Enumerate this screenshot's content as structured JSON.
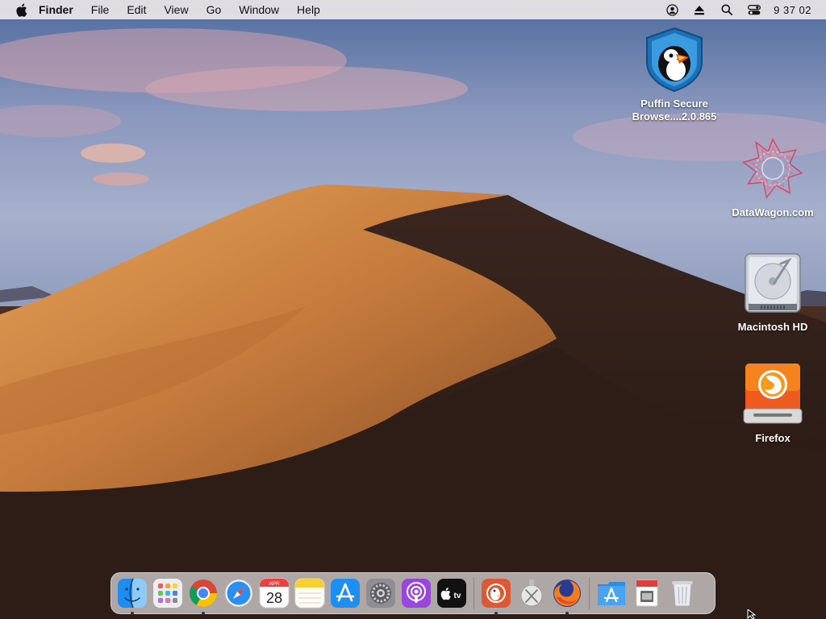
{
  "menubar": {
    "app_name": "Finder",
    "menus": [
      "File",
      "Edit",
      "View",
      "Go",
      "Window",
      "Help"
    ],
    "clock": "9 37 02",
    "status_icons": [
      "user-icon",
      "eject-icon",
      "search-icon",
      "control-center-icon"
    ]
  },
  "desktop": {
    "icons": [
      {
        "label": "Puffin Secure\nBrowse....2.0.865",
        "icon": "puffin-icon"
      },
      {
        "label": "DataWagon.com",
        "icon": "datawagon-icon"
      },
      {
        "label": "Macintosh HD",
        "icon": "hard-drive-icon"
      },
      {
        "label": "Firefox",
        "icon": "firefox-drive-icon"
      }
    ]
  },
  "dock": {
    "calendar_month": "APR",
    "calendar_day": "28",
    "tv_label": "tv",
    "apps": [
      {
        "name": "Finder",
        "icon": "finder-icon",
        "running": true
      },
      {
        "name": "Launchpad",
        "icon": "launchpad-icon",
        "running": false
      },
      {
        "name": "Chrome",
        "icon": "chrome-icon",
        "running": true
      },
      {
        "name": "Safari",
        "icon": "safari-icon",
        "running": false
      },
      {
        "name": "Calendar",
        "icon": "calendar-icon",
        "running": false
      },
      {
        "name": "Notes",
        "icon": "notes-icon",
        "running": false
      },
      {
        "name": "App Store",
        "icon": "app-store-icon",
        "running": false
      },
      {
        "name": "System Preferences",
        "icon": "settings-icon",
        "running": false
      },
      {
        "name": "Podcasts",
        "icon": "podcasts-icon",
        "running": false
      },
      {
        "name": "Apple TV",
        "icon": "apple-tv-icon",
        "running": false
      },
      {
        "name": "DuckDuckGo",
        "icon": "duckduckgo-icon",
        "running": true
      },
      {
        "name": "macOS Installer",
        "icon": "installer-icon",
        "running": false
      },
      {
        "name": "Firefox",
        "icon": "firefox-icon",
        "running": true
      },
      {
        "name": "Applications",
        "icon": "applications-folder-icon",
        "running": false
      },
      {
        "name": "Preview",
        "icon": "preview-icon",
        "running": false
      },
      {
        "name": "Trash",
        "icon": "trash-icon",
        "running": false
      }
    ]
  },
  "colors": {
    "menubar_bg": "#ece6e8",
    "sky_top": "#5a78a8",
    "sky_pink": "#d9a2a8",
    "dune_light": "#d9914a",
    "dune_dark": "#2c1d18",
    "puffin_blue": "#2a7fc1"
  }
}
